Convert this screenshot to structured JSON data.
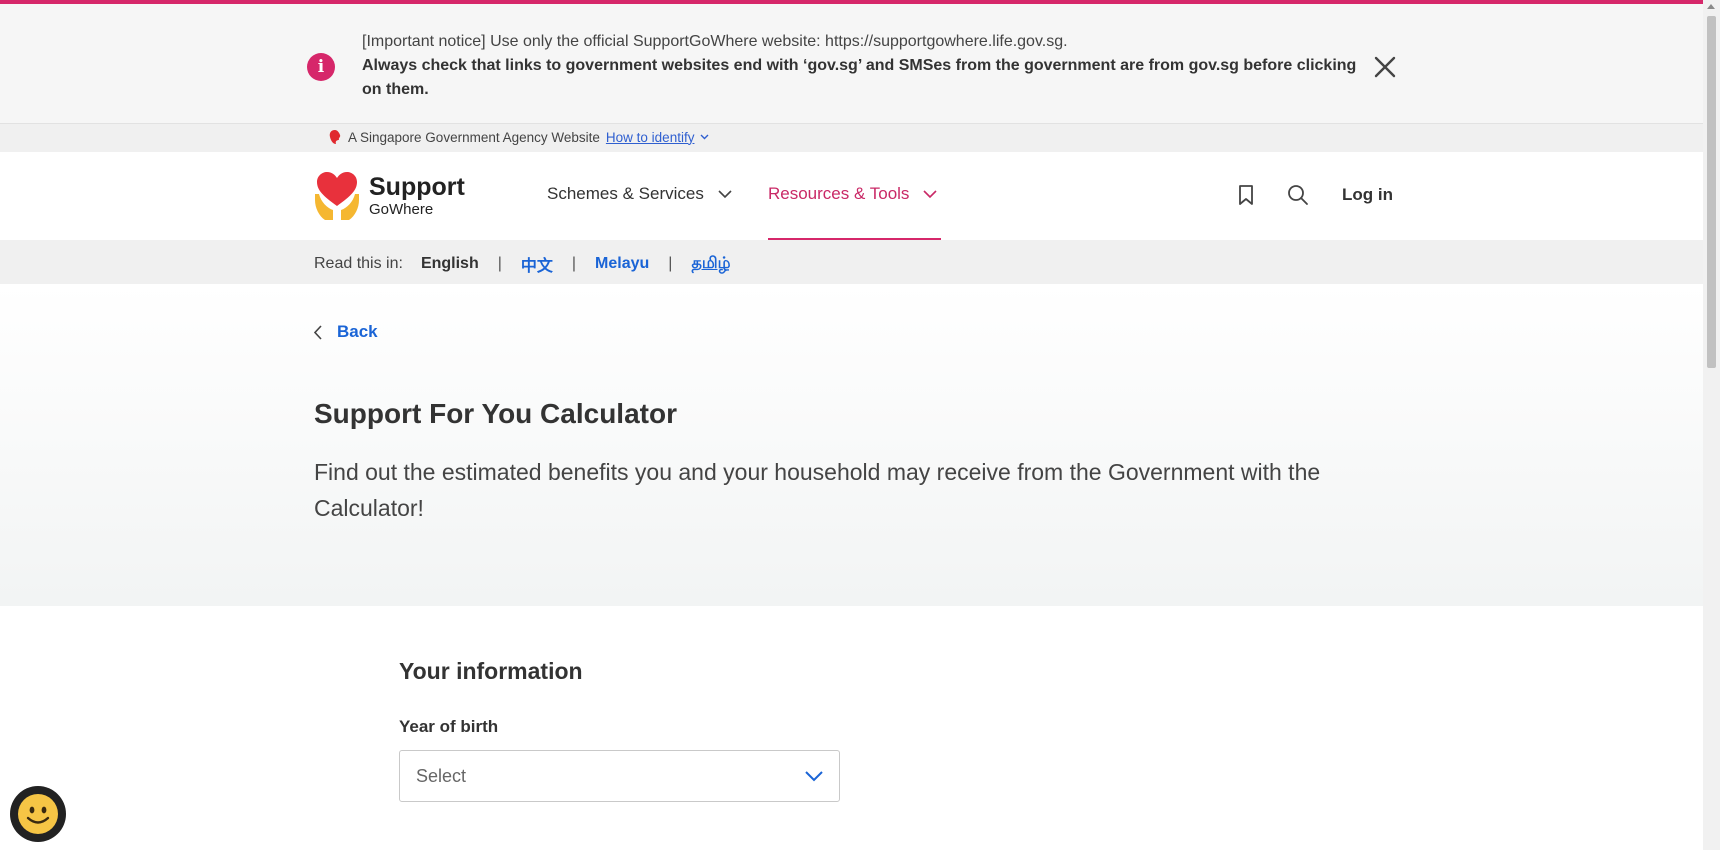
{
  "notice": {
    "line1": "[Important notice] Use only the official SupportGoWhere website: https://supportgowhere.life.gov.sg.",
    "line2": "Always check that links to government websites end with ‘gov.sg’ and SMSes from the government are from gov.sg before clicking on them.",
    "icon": "info-icon",
    "close_icon": "close-icon",
    "accent": "#d6276a"
  },
  "gov_bar": {
    "text": "A Singapore Government Agency Website",
    "link": "How to identify"
  },
  "header": {
    "logo_line1": "Support",
    "logo_line2": "GoWhere",
    "nav": [
      {
        "label": "Schemes & Services"
      },
      {
        "label": "Resources & Tools"
      }
    ],
    "bookmark_icon": "bookmark-icon",
    "search_icon": "search-icon",
    "login": "Log in"
  },
  "languages": {
    "label": "Read this in:",
    "current": "English",
    "options": [
      "中文",
      "Melayu",
      "தமிழ்"
    ]
  },
  "hero": {
    "back": "Back",
    "title": "Support For You Calculator",
    "description": "Find out the estimated benefits you and your household may receive from the Government with the Calculator!"
  },
  "form": {
    "section_title": "Your information",
    "year_label": "Year of birth",
    "year_value": "Select"
  },
  "chat": {
    "icon": "smiley-chat-icon"
  },
  "colors": {
    "brand_pink": "#d6276a",
    "link_blue": "#1a64d6"
  }
}
